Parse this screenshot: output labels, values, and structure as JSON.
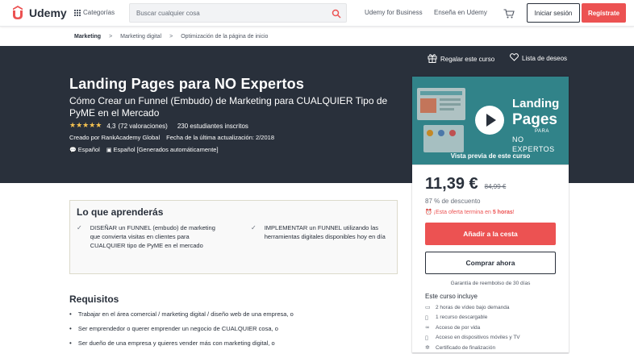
{
  "header": {
    "logo_text": "Udemy",
    "categories_label": "Categorías",
    "search_placeholder": "Buscar cualquier cosa",
    "business_link": "Udemy for Business",
    "teach_link": "Enseña en Udemy",
    "login_label": "Iniciar sesión",
    "signup_label": "Regístrate"
  },
  "breadcrumb": {
    "items": [
      "Marketing",
      "Marketing digital",
      "Optimización de la página de inicio"
    ],
    "separator": ">"
  },
  "hero": {
    "gift_label": "Regalar este curso",
    "wishlist_label": "Lista de deseos",
    "title": "Landing Pages para NO Expertos",
    "subtitle": "Cómo Crear un Funnel (Embudo) de Marketing para CUALQUIER Tipo de PyME en el Mercado",
    "rating_value": "4,3",
    "rating_count": "(72 valoraciones)",
    "students": "230 estudiantes inscritos",
    "created_by": "Creado por RankAcademy Global",
    "last_update": "Fecha de la última actualización: 2/2018",
    "language": "Español",
    "captions": "Español [Generados automáticamente]"
  },
  "sidebar": {
    "preview": {
      "thumb_line1": "Landing",
      "thumb_line2": "Pages",
      "thumb_line3": "PARA",
      "thumb_line4": "NO EXPERTOS",
      "label": "Vista previa de este curso"
    },
    "price": "11,39 €",
    "old_price": "84,99 €",
    "discount": "87 % de descuento",
    "offer_prefix": "¡Esta oferta termina en",
    "offer_time": "5 horas",
    "offer_suffix": "!",
    "add_to_cart": "Añadir a la cesta",
    "buy_now": "Comprar ahora",
    "guarantee": "Garantía de reembolso de 30 días",
    "includes_title": "Este curso incluye",
    "includes": [
      {
        "icon": "video-icon",
        "text": "2 horas de vídeo bajo demanda"
      },
      {
        "icon": "file-icon",
        "text": "1 recurso descargable"
      },
      {
        "icon": "infinity-icon",
        "text": "Acceso de por vida"
      },
      {
        "icon": "mobile-icon",
        "text": "Acceso en dispositivos móviles y TV"
      },
      {
        "icon": "certificate-icon",
        "text": "Certificado de finalización"
      }
    ]
  },
  "learn": {
    "title": "Lo que aprenderás",
    "items": [
      "DISEÑAR un FUNNEL (embudo) de marketing que convierta visitas en clientes para CUALQUIER tipo de PyME en el mercado",
      "IMPLEMENTAR un FUNNEL utilizando las herramientas digitales disponibles hoy en día"
    ]
  },
  "requirements": {
    "title": "Requisitos",
    "items": [
      "Trabajar en el área comercial / marketing digital / diseño web de una empresa, o",
      "Ser emprendedor o querer emprender un negocio de CUALQUIER cosa, o",
      "Ser dueño de una empresa y quieres vender más con marketing digital, o"
    ]
  },
  "colors": {
    "brand": "#ec5252",
    "hero_bg": "#29303b",
    "star": "#f4c150"
  }
}
